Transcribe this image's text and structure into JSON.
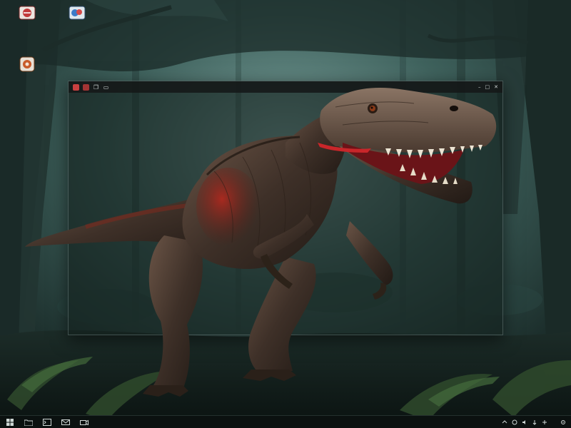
{
  "desktop": {
    "icons": [
      {
        "label": "",
        "icon": "app-icon-red"
      },
      {
        "label": "",
        "icon": "app-icon-blue"
      },
      {
        "label": "",
        "icon": "app-icon-orange"
      }
    ]
  },
  "window": {
    "title": "",
    "menu": [
      "",
      "",
      "",
      "",
      ""
    ],
    "lines": [
      "",
      "",
      "",
      "",
      "",
      "",
      "",
      "",
      "",
      "",
      ""
    ],
    "titlebar_buttons": [
      "close-icon",
      "minimize-icon",
      "copy-icon",
      "tab-icon"
    ],
    "controls": [
      "minimize-icon",
      "maximize-icon",
      "close-icon"
    ]
  },
  "taskbar": {
    "buttons": [
      "start-icon",
      "file-explorer-icon",
      "terminal-icon",
      "mail-icon",
      "camera-icon"
    ],
    "tray": [
      "chevron-up-icon",
      "network-icon",
      "volume-icon",
      "battery-icon",
      "notification-icon",
      "settings-icon"
    ],
    "clock_time": "",
    "clock_date": "",
    "locale": ""
  },
  "colors": {
    "accent_red": "#c94040",
    "taskbar_bg": "#0b1110",
    "terminal_text": "#b8c8c4"
  }
}
